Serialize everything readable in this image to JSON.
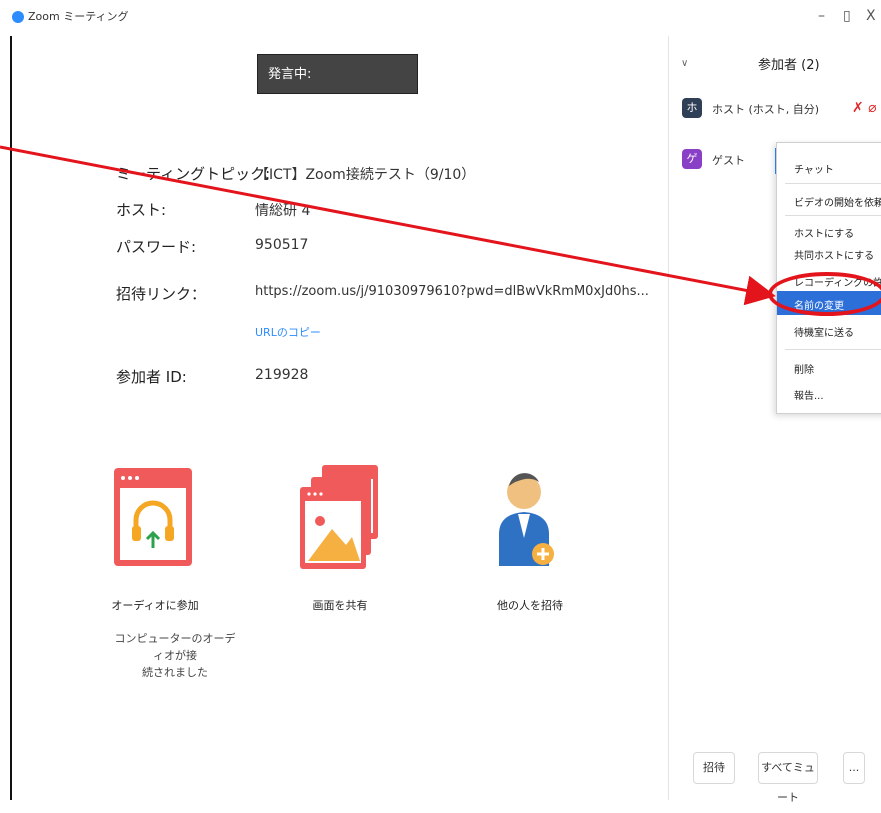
{
  "window": {
    "title": "Zoom ミーティング",
    "minimize": "–",
    "maximize": "▯",
    "close": "X"
  },
  "speaking_label": "発言中:",
  "meeting_info": {
    "topic_label": "ミーティングトピック:",
    "topic_value": "【ICT】Zoom接続テスト（9/10）",
    "host_label": "ホスト:",
    "host_value": "情総研 4",
    "password_label": "パスワード:",
    "password_value": "950517",
    "invite_label": "招待リンク：",
    "invite_value": "https://zoom.us/j/91030979610?pwd=dlBwVkRmM0xJd0hs...",
    "copy_url_label": "URLのコピー",
    "participant_id_label": "参加者 ID:",
    "participant_id_value": "219928"
  },
  "actions": [
    {
      "label": "オーディオに参加",
      "icon": "headphones-icon"
    },
    {
      "label": "画面を共有",
      "icon": "share-screen-icon"
    },
    {
      "label": "他の人を招待",
      "icon": "invite-person-icon"
    }
  ],
  "audio_status_line1": "コンピューターのオーディオが接",
  "audio_status_line2": "続されました",
  "panel": {
    "title": "参加者 (2)",
    "participants": [
      {
        "initial": "ホ",
        "name": "ホスト (ホスト, 自分)",
        "color": "#2f3f55"
      },
      {
        "initial": "ゲ",
        "name": "ゲスト",
        "color": "#8a3fc7"
      }
    ],
    "menu": [
      {
        "label": "チャット"
      },
      {
        "label": "ビデオの開始を依頼"
      },
      {
        "label": "ホストにする"
      },
      {
        "label": "共同ホストにする"
      },
      {
        "label": "レコーディングの許可"
      },
      {
        "label": "名前の変更"
      },
      {
        "label": "待機室に送る"
      },
      {
        "label": "削除"
      },
      {
        "label": "報告..."
      }
    ],
    "footer": {
      "invite": "招待",
      "mute_all": "すべてミュート",
      "more": "..."
    }
  },
  "colors": {
    "accent": "#2d8cff",
    "annotation": "#e3141b",
    "speaking_bg": "#444444",
    "action_red": "#f05a5a"
  }
}
